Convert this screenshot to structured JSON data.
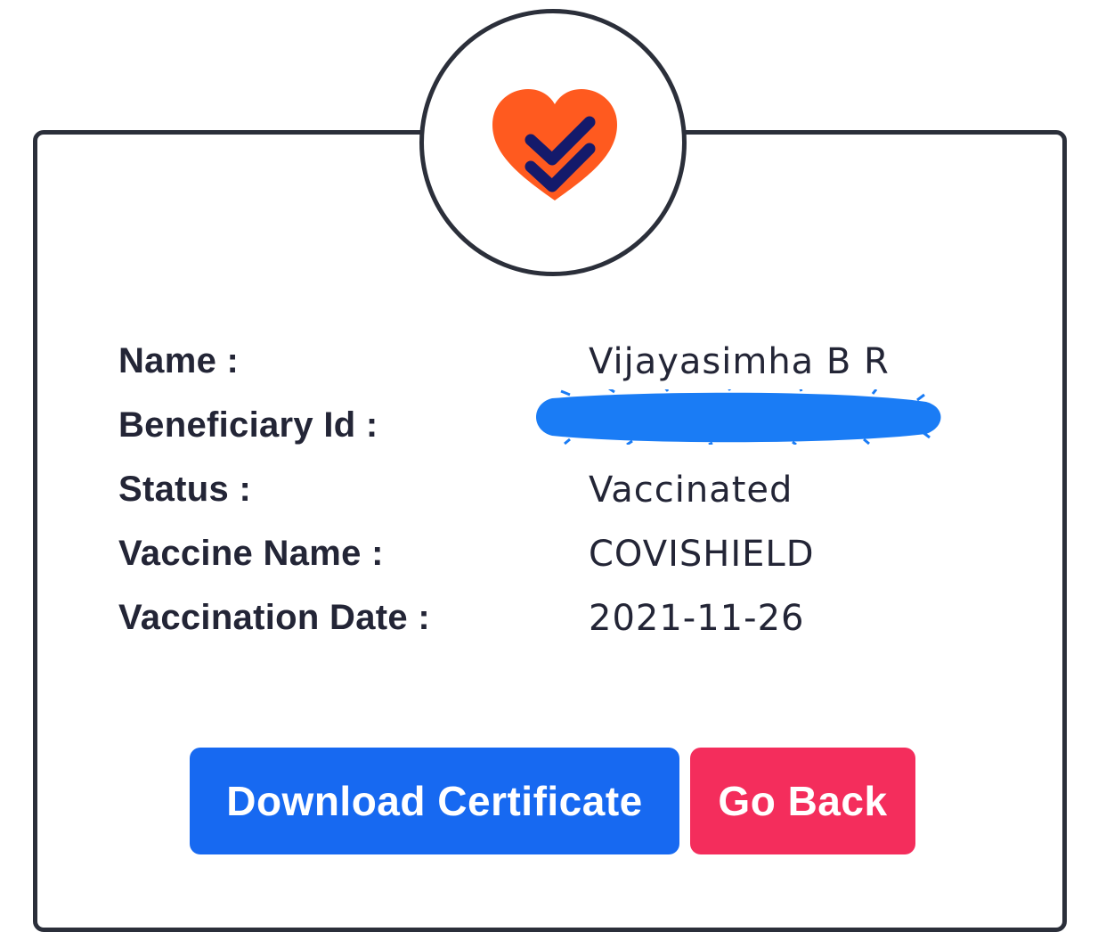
{
  "logo": {
    "icon": "heart-check-icon",
    "heart_color": "#ff5a1f",
    "check_color": "#141a6b"
  },
  "details": [
    {
      "label": "Name :",
      "value": "Vijayasimha B R"
    },
    {
      "label": "Beneficiary Id :",
      "value": ""
    },
    {
      "label": "Status :",
      "value": "Vaccinated"
    },
    {
      "label": "Vaccine Name :",
      "value": "COVISHIELD"
    },
    {
      "label": "Vaccination Date :",
      "value": "2021-11-26"
    }
  ],
  "redaction_color": "#1a7cf5",
  "actions": {
    "download_label": "Download Certificate",
    "back_label": "Go Back",
    "download_color": "#1769f1",
    "back_color": "#f42d5c"
  }
}
